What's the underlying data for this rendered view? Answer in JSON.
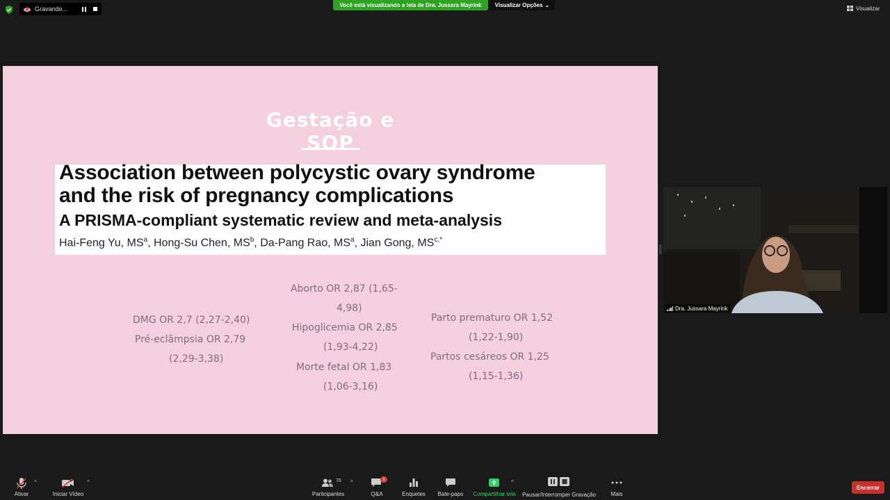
{
  "topbar": {
    "recording_label": "Gravando...",
    "banner": "Você está visualizando a tela de Dra. Jussara Mayrink",
    "view_options": "Visualizar Opções",
    "view_options_caret": "⌄",
    "view_label": "Visualizar"
  },
  "slide": {
    "title": "Gestação e SOP",
    "paper": {
      "title_line1": "Association between polycystic ovary syndrome",
      "title_line2": "and the risk of pregnancy complications",
      "subtitle": "A PRISMA-compliant systematic review and meta-analysis",
      "authors": [
        {
          "name": "Hai-Feng Yu, MS",
          "sup": "a",
          "sep": ", "
        },
        {
          "name": "Hong-Su Chen, MS",
          "sup": "b",
          "sep": ", "
        },
        {
          "name": "Da-Pang Rao, MS",
          "sup": "a",
          "sep": ", "
        },
        {
          "name": "Jian Gong, MS",
          "sup": "c,*",
          "sep": ""
        }
      ]
    },
    "col1": [
      "DMG OR 2,7 (2,27-2,40)",
      "Pré-eclâmpsia OR 2,79",
      "(2,29-3,38)"
    ],
    "col2": [
      "Aborto OR 2,87 (1,65-",
      "4,98)",
      "Hipoglicemia OR 2,85",
      "(1,93-4,22)",
      "Morte fetal OR 1,83",
      "(1,06-3,16)"
    ],
    "col3": [
      "Parto prematuro OR 1,52",
      "(1,22-1,90)",
      "Partos cesáreos OR 1,25",
      "(1,15-1,36)"
    ]
  },
  "video": {
    "participant_name": "Dra. Jussara Mayrink"
  },
  "toolbar": {
    "mute_label": "Ativar",
    "video_label": "Iniciar Vídeo",
    "participants_label": "Participantes",
    "participants_count": "78",
    "qa_label": "Q&A",
    "qa_badge": "1",
    "polls_label": "Enquetes",
    "chat_label": "Bate-papo",
    "share_label": "Compartilhar tela",
    "record_label": "Pausar/Interromper Gravação",
    "more_label": "Mais",
    "end_label": "Encerrar",
    "caret": "^"
  },
  "colors": {
    "slide_bg": "#f4d0df",
    "banner_green": "#2da41f",
    "share_green": "#23d959",
    "end_red": "#c9302c",
    "stat_text": "#7d6d7e"
  }
}
